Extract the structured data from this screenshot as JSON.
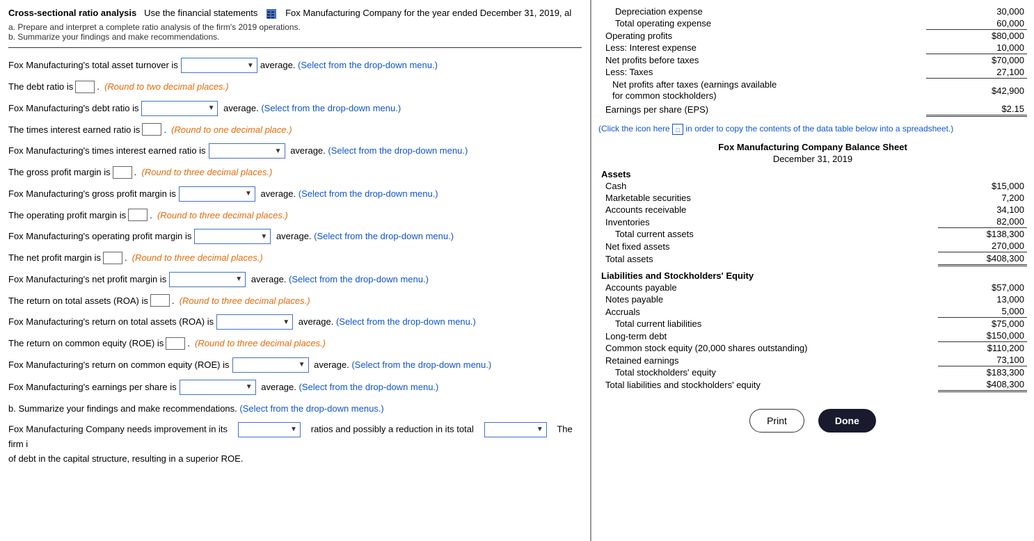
{
  "header": {
    "title": "Cross-sectional ratio analysis",
    "instruction": "Use the financial statements",
    "company": "Fox Manufacturing Company for the year ended December 31, 2019, al",
    "sub_a": "a. Prepare and interpret a complete ratio analysis of the firm's 2019 operations.",
    "sub_b": "b. Summarize your findings and make recommendations."
  },
  "form": {
    "q1_label": "Fox Manufacturing's total asset turnover is",
    "q1_after": "average.",
    "q1_select_note": "(Select from the drop-down menu.)",
    "q2_label": "The debt ratio is",
    "q2_round": "(Round to two decimal places.)",
    "q3_label": "Fox Manufacturing's debt ratio is",
    "q3_after": "average.",
    "q3_select_note": "(Select from the drop-down menu.)",
    "q4_label": "The times interest earned ratio is",
    "q4_round": "(Round to one decimal place.)",
    "q5_label": "Fox Manufacturing's times interest earned ratio is",
    "q5_after": "average.",
    "q5_select_note": "(Select from the drop-down menu.)",
    "q6_label": "The gross profit margin is",
    "q6_round": "(Round to three decimal places.)",
    "q7_label": "Fox Manufacturing's gross profit margin is",
    "q7_after": "average.",
    "q7_select_note": "(Select from the drop-down menu.)",
    "q8_label": "The operating profit margin is",
    "q8_round": "(Round to three decimal places.)",
    "q9_label": "Fox Manufacturing's operating profit margin is",
    "q9_after": "average.",
    "q9_select_note": "(Select from the drop-down menu.)",
    "q10_label": "The net profit margin is",
    "q10_round": "(Round to three decimal places.)",
    "q11_label": "Fox Manufacturing's net profit margin is",
    "q11_after": "average.",
    "q11_select_note": "(Select from the drop-down menu.)",
    "q12_label": "The return on total assets (ROA) is",
    "q12_round": "(Round to three decimal places.)",
    "q13_label": "Fox Manufacturing's return on total assets (ROA) is",
    "q13_after": "average.",
    "q13_select_note": "(Select from the drop-down menu.)",
    "q14_label": "The return on common equity (ROE) is",
    "q14_round": "(Round to three decimal places.)",
    "q15_label": "Fox Manufacturing's return on common equity (ROE) is",
    "q15_after": "average.",
    "q15_select_note": "(Select from the drop-down menu.)",
    "q16_label": "Fox Manufacturing's earnings per share is",
    "q16_after": "average.",
    "q16_select_note": "(Select from the drop-down menu.)",
    "q17_label": "b. Summarize your findings and make recommendations.",
    "q17_select_note": "(Select from the drop-down menus.)",
    "q18_label1": "Fox Manufacturing Company needs improvement in its",
    "q18_label2": "ratios and possibly a reduction in its total",
    "q18_label3": "The firm i",
    "q18_label4": "of debt in the capital structure, resulting in a superior ROE."
  },
  "right_panel": {
    "income_statement": {
      "rows": [
        {
          "label": "Depreciation expense",
          "indent": 1,
          "value": "30,000",
          "border": false
        },
        {
          "label": "Total operating expense",
          "indent": 1,
          "value": "60,000",
          "border": true
        },
        {
          "label": "Operating profits",
          "indent": 0,
          "value": "$80,000",
          "border": false
        },
        {
          "label": "Less: Interest expense",
          "indent": 0,
          "value": "10,000",
          "border": true
        },
        {
          "label": "Net profits before taxes",
          "indent": 0,
          "value": "$70,000",
          "border": false
        },
        {
          "label": "Less: Taxes",
          "indent": 0,
          "value": "27,100",
          "border": true
        },
        {
          "label": "Net profits after taxes (earnings available for common stockholders)",
          "indent": 1,
          "value": "$42,900",
          "border": false
        },
        {
          "label": "Earnings per share (EPS)",
          "indent": 0,
          "value": "$2.15",
          "border": false,
          "double_border": true
        }
      ]
    },
    "click_note": "(Click the icon here",
    "click_note2": "in order to copy the contents of the data table below into a spreadsheet.)",
    "balance_sheet": {
      "title": "Fox Manufacturing Company Balance Sheet",
      "subtitle": "December 31, 2019",
      "assets_header": "Assets",
      "assets": [
        {
          "label": "Cash",
          "indent": 0,
          "value": "$15,000"
        },
        {
          "label": "Marketable securities",
          "indent": 0,
          "value": "7,200"
        },
        {
          "label": "Accounts receivable",
          "indent": 0,
          "value": "34,100"
        },
        {
          "label": "Inventories",
          "indent": 0,
          "value": "82,000",
          "border": true
        },
        {
          "label": "Total current assets",
          "indent": 1,
          "value": "$138,300"
        },
        {
          "label": "Net fixed assets",
          "indent": 0,
          "value": "270,000",
          "border": true
        },
        {
          "label": "Total assets",
          "indent": 0,
          "value": "$408,300",
          "double_border": true
        }
      ],
      "liabilities_header": "Liabilities and Stockholders' Equity",
      "liabilities": [
        {
          "label": "Accounts payable",
          "indent": 0,
          "value": "$57,000"
        },
        {
          "label": "Notes payable",
          "indent": 0,
          "value": "13,000"
        },
        {
          "label": "Accruals",
          "indent": 0,
          "value": "5,000",
          "border": true
        },
        {
          "label": "Total current liabilities",
          "indent": 1,
          "value": "$75,000"
        },
        {
          "label": "Long-term debt",
          "indent": 0,
          "value": "$150,000",
          "border": true
        },
        {
          "label": "Common stock equity (20,000 shares outstanding)",
          "indent": 0,
          "value": "$110,200"
        },
        {
          "label": "Retained earnings",
          "indent": 0,
          "value": "73,100",
          "border": true
        },
        {
          "label": "Total stockholders' equity",
          "indent": 1,
          "value": "$183,300"
        },
        {
          "label": "Total liabilities and stockholders' equity",
          "indent": 0,
          "value": "$408,300",
          "double_border": true
        }
      ]
    }
  },
  "buttons": {
    "print": "Print",
    "done": "Done"
  }
}
